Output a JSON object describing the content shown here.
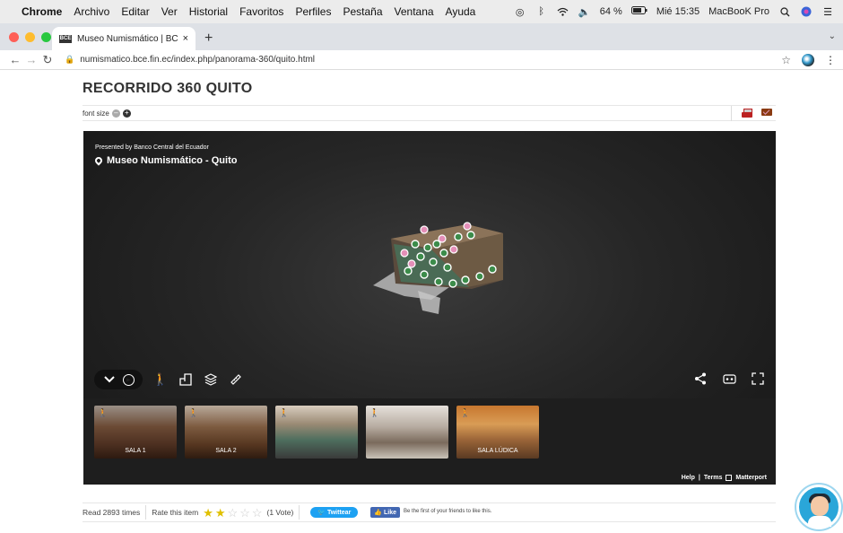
{
  "menubar": {
    "apple": "",
    "app": "Chrome",
    "items": [
      "Archivo",
      "Editar",
      "Ver",
      "Historial",
      "Favoritos",
      "Perfiles",
      "Pestaña",
      "Ventana",
      "Ayuda"
    ],
    "battery": "64 %",
    "clock": "Mié 15:35",
    "device": "MacBooK Pro"
  },
  "tab": {
    "favicon": "BCE",
    "title": "Museo Numismático | BCE - Q",
    "close": "×",
    "new": "+"
  },
  "address": {
    "url": "numismatico.bce.fin.ec/index.php/panorama-360/quito.html"
  },
  "page": {
    "title": "RECORRIDO 360 QUITO",
    "font_size_label": "font size"
  },
  "viewer": {
    "presented": "Presented by Banco Central del Ecuador",
    "place": "Museo Numismático - Quito",
    "thumbnails": [
      {
        "label": "SALA 1"
      },
      {
        "label": "SALA 2"
      },
      {
        "label": ""
      },
      {
        "label": ""
      },
      {
        "label": "SALA LÚDICA"
      }
    ],
    "help": "Help",
    "terms": "Terms",
    "brand": "Matterport",
    "divider": "|"
  },
  "footer": {
    "reads": "Read 2893 times",
    "rate": "Rate this item",
    "rating": 2,
    "max_rating": 5,
    "votes": "(1 Vote)",
    "twitter": "Twittear",
    "like": "Like",
    "fb_text": "Be the first of your friends to like this."
  },
  "colors": {
    "viewer_bg": "#262626",
    "twitter": "#1da1f2",
    "facebook": "#4267b2",
    "chat": "#2aa6d9"
  }
}
